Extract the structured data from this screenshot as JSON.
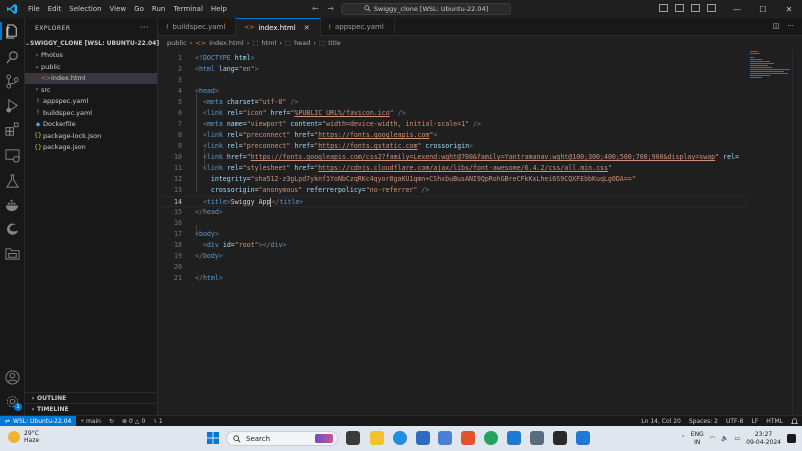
{
  "titlebar": {
    "menu": [
      "File",
      "Edit",
      "Selection",
      "View",
      "Go",
      "Run",
      "Terminal",
      "Help"
    ],
    "command_center": "Swiggy_clone [WSL: Ubuntu-22.04]",
    "back_arrow": "←",
    "forward_arrow": "→",
    "minimize": "—",
    "maximize": "☐",
    "close": "✕"
  },
  "activity_bar": [
    "explorer-icon",
    "search-icon",
    "source-control-icon",
    "run-debug-icon",
    "extensions-icon",
    "remote-explorer-icon",
    "testing-icon",
    "docker-icon",
    "edge-devtools-icon",
    "project-manager-icon",
    "accounts-icon",
    "manage-gear-icon"
  ],
  "sidebar": {
    "title": "EXPLORER",
    "more": "···",
    "root": "SWIGGY_CLONE [WSL: UBUNTU-22.04]",
    "items": [
      {
        "label": "Photos",
        "depth": 1,
        "type": "folder-closed"
      },
      {
        "label": "public",
        "depth": 1,
        "type": "folder-open"
      },
      {
        "label": "index.html",
        "depth": 2,
        "type": "html",
        "selected": true
      },
      {
        "label": "src",
        "depth": 1,
        "type": "folder-closed"
      },
      {
        "label": "appspec.yaml",
        "depth": 1,
        "type": "yaml"
      },
      {
        "label": "buildspec.yaml",
        "depth": 1,
        "type": "yaml"
      },
      {
        "label": "Dockerfile",
        "depth": 1,
        "type": "docker"
      },
      {
        "label": "package-lock.json",
        "depth": 1,
        "type": "json"
      },
      {
        "label": "package.json",
        "depth": 1,
        "type": "json"
      }
    ],
    "outline": "OUTLINE",
    "timeline": "TIMELINE"
  },
  "tabs": [
    {
      "label": "buildspec.yaml",
      "icon": "!",
      "active": false
    },
    {
      "label": "index.html",
      "icon": "<>",
      "active": true
    },
    {
      "label": "appspec.yaml",
      "icon": "!",
      "active": false
    }
  ],
  "breadcrumb": [
    "public",
    "index.html",
    "html",
    "head",
    "title"
  ],
  "editor": {
    "current_line": 14,
    "lines": [
      {
        "n": "1",
        "tokens": [
          [
            "br",
            "<!"
          ],
          [
            "tag",
            "DOCTYPE"
          ],
          [
            "txt",
            " "
          ],
          [
            "attr",
            "html"
          ],
          [
            "br",
            ">"
          ]
        ]
      },
      {
        "n": "2",
        "tokens": [
          [
            "br",
            "<"
          ],
          [
            "tag",
            "html"
          ],
          [
            "txt",
            " "
          ],
          [
            "attr",
            "lang"
          ],
          [
            "txt",
            "="
          ],
          [
            "str",
            "\"en\""
          ],
          [
            "br",
            ">"
          ]
        ]
      },
      {
        "n": "3",
        "tokens": []
      },
      {
        "n": "4",
        "tokens": [
          [
            "br",
            "<"
          ],
          [
            "tag",
            "head"
          ],
          [
            "br",
            ">"
          ]
        ]
      },
      {
        "n": "5",
        "tokens": [
          [
            "txt",
            "  "
          ],
          [
            "br",
            "<"
          ],
          [
            "tag",
            "meta"
          ],
          [
            "txt",
            " "
          ],
          [
            "attr",
            "charset"
          ],
          [
            "txt",
            "="
          ],
          [
            "str",
            "\"utf-8\""
          ],
          [
            "txt",
            " "
          ],
          [
            "br",
            "/>"
          ]
        ]
      },
      {
        "n": "6",
        "tokens": [
          [
            "txt",
            "  "
          ],
          [
            "br",
            "<"
          ],
          [
            "tag",
            "link"
          ],
          [
            "txt",
            " "
          ],
          [
            "attr",
            "rel"
          ],
          [
            "txt",
            "="
          ],
          [
            "str",
            "\"icon\""
          ],
          [
            "txt",
            " "
          ],
          [
            "attr",
            "href"
          ],
          [
            "txt",
            "="
          ],
          [
            "str",
            "\""
          ],
          [
            "url",
            "%PUBLIC_URL%/favicon.ico"
          ],
          [
            "str",
            "\""
          ],
          [
            "txt",
            " "
          ],
          [
            "br",
            "/>"
          ]
        ]
      },
      {
        "n": "7",
        "tokens": [
          [
            "txt",
            "  "
          ],
          [
            "br",
            "<"
          ],
          [
            "tag",
            "meta"
          ],
          [
            "txt",
            " "
          ],
          [
            "attr",
            "name"
          ],
          [
            "txt",
            "="
          ],
          [
            "str",
            "\"viewport\""
          ],
          [
            "txt",
            " "
          ],
          [
            "attr",
            "content"
          ],
          [
            "txt",
            "="
          ],
          [
            "str",
            "\"width=device-width, initial-scale=1\""
          ],
          [
            "txt",
            " "
          ],
          [
            "br",
            "/>"
          ]
        ]
      },
      {
        "n": "8",
        "tokens": [
          [
            "txt",
            "  "
          ],
          [
            "br",
            "<"
          ],
          [
            "tag",
            "link"
          ],
          [
            "txt",
            " "
          ],
          [
            "attr",
            "rel"
          ],
          [
            "txt",
            "="
          ],
          [
            "str",
            "\"preconnect\""
          ],
          [
            "txt",
            " "
          ],
          [
            "attr",
            "href"
          ],
          [
            "txt",
            "="
          ],
          [
            "str",
            "\""
          ],
          [
            "url",
            "https://fonts.googleapis.com"
          ],
          [
            "str",
            "\""
          ],
          [
            "br",
            ">"
          ]
        ]
      },
      {
        "n": "9",
        "tokens": [
          [
            "txt",
            "  "
          ],
          [
            "br",
            "<"
          ],
          [
            "tag",
            "link"
          ],
          [
            "txt",
            " "
          ],
          [
            "attr",
            "rel"
          ],
          [
            "txt",
            "="
          ],
          [
            "str",
            "\"preconnect\""
          ],
          [
            "txt",
            " "
          ],
          [
            "attr",
            "href"
          ],
          [
            "txt",
            "="
          ],
          [
            "str",
            "\""
          ],
          [
            "url",
            "https://fonts.gstatic.com"
          ],
          [
            "str",
            "\""
          ],
          [
            "txt",
            " "
          ],
          [
            "attr",
            "crossorigin"
          ],
          [
            "br",
            ">"
          ]
        ]
      },
      {
        "n": "10",
        "tokens": [
          [
            "txt",
            "  "
          ],
          [
            "br",
            "<"
          ],
          [
            "tag",
            "link"
          ],
          [
            "txt",
            " "
          ],
          [
            "attr",
            "href"
          ],
          [
            "txt",
            "="
          ],
          [
            "str",
            "\""
          ],
          [
            "url",
            "https://fonts.googleapis.com/css2?family=Lexend:wght@700&family=Yantramanav:wght@100;300;400;500;700;900&display=swap"
          ],
          [
            "str",
            "\""
          ],
          [
            "txt",
            " "
          ],
          [
            "attr",
            "rel"
          ],
          [
            "txt",
            "="
          ]
        ]
      },
      {
        "n": "11",
        "tokens": [
          [
            "txt",
            "  "
          ],
          [
            "br",
            "<"
          ],
          [
            "tag",
            "link"
          ],
          [
            "txt",
            " "
          ],
          [
            "attr",
            "rel"
          ],
          [
            "txt",
            "="
          ],
          [
            "str",
            "\"stylesheet\""
          ],
          [
            "txt",
            " "
          ],
          [
            "attr",
            "href"
          ],
          [
            "txt",
            "="
          ],
          [
            "str",
            "\""
          ],
          [
            "url",
            "https://cdnjs.cloudflare.com/ajax/libs/font-awesome/6.4.2/css/all.min.css"
          ],
          [
            "str",
            "\""
          ]
        ]
      },
      {
        "n": "12",
        "tokens": [
          [
            "txt",
            "    "
          ],
          [
            "attr",
            "integrity"
          ],
          [
            "txt",
            "="
          ],
          [
            "str",
            "\"sha512-z3gLpd7yknf1YoNbCzqRKc4qyor8gaKU1qmn+CShxbuBusANI9QpRohGBreCFkKxLhei6S9CQXFEbbKuqLg0DA==\""
          ]
        ]
      },
      {
        "n": "13",
        "tokens": [
          [
            "txt",
            "    "
          ],
          [
            "attr",
            "crossorigin"
          ],
          [
            "txt",
            "="
          ],
          [
            "str",
            "\"anonymous\""
          ],
          [
            "txt",
            " "
          ],
          [
            "attr",
            "referrerpolicy"
          ],
          [
            "txt",
            "="
          ],
          [
            "str",
            "\"no-referrer\""
          ],
          [
            "txt",
            " "
          ],
          [
            "br",
            "/>"
          ]
        ]
      },
      {
        "n": "14",
        "tokens": [
          [
            "txt",
            "  "
          ],
          [
            "br",
            "<"
          ],
          [
            "tag",
            "title"
          ],
          [
            "br",
            ">"
          ],
          [
            "txt",
            "Swiggy App"
          ],
          [
            "cursor",
            ""
          ],
          [
            "br",
            "</"
          ],
          [
            "tag",
            "title"
          ],
          [
            "br",
            ">"
          ]
        ]
      },
      {
        "n": "15",
        "tokens": [
          [
            "br",
            "</"
          ],
          [
            "tag",
            "head"
          ],
          [
            "br",
            ">"
          ]
        ]
      },
      {
        "n": "16",
        "tokens": []
      },
      {
        "n": "17",
        "tokens": [
          [
            "br",
            "<"
          ],
          [
            "tag",
            "body"
          ],
          [
            "br",
            ">"
          ]
        ]
      },
      {
        "n": "18",
        "tokens": [
          [
            "txt",
            "  "
          ],
          [
            "br",
            "<"
          ],
          [
            "tag",
            "div"
          ],
          [
            "txt",
            " "
          ],
          [
            "attr",
            "id"
          ],
          [
            "txt",
            "="
          ],
          [
            "str",
            "\"root\""
          ],
          [
            "br",
            "></"
          ],
          [
            "tag",
            "div"
          ],
          [
            "br",
            ">"
          ]
        ]
      },
      {
        "n": "19",
        "tokens": [
          [
            "br",
            "</"
          ],
          [
            "tag",
            "body"
          ],
          [
            "br",
            ">"
          ]
        ]
      },
      {
        "n": "20",
        "tokens": []
      },
      {
        "n": "21",
        "tokens": [
          [
            "br",
            "</"
          ],
          [
            "tag",
            "html"
          ],
          [
            "br",
            ">"
          ]
        ]
      }
    ]
  },
  "statusbar": {
    "remote": "WSL: Ubuntu-22.04",
    "branch": "main",
    "sync": "↻",
    "errors": "0",
    "warnings": "0",
    "info": "1",
    "position": "Ln 14, Col 20",
    "spaces": "Spaces: 2",
    "encoding": "UTF-8",
    "eol": "LF",
    "language": "HTML",
    "bell": "🔔"
  },
  "taskbar": {
    "temperature": "29°C",
    "weather": "Haze",
    "search_placeholder": "Search",
    "lang_line1": "ENG",
    "lang_line2": "IN",
    "time": "23:27",
    "date": "09-04-2024",
    "colors": {
      "blue": "#0078d4",
      "vscode": "#23a9f2"
    }
  }
}
